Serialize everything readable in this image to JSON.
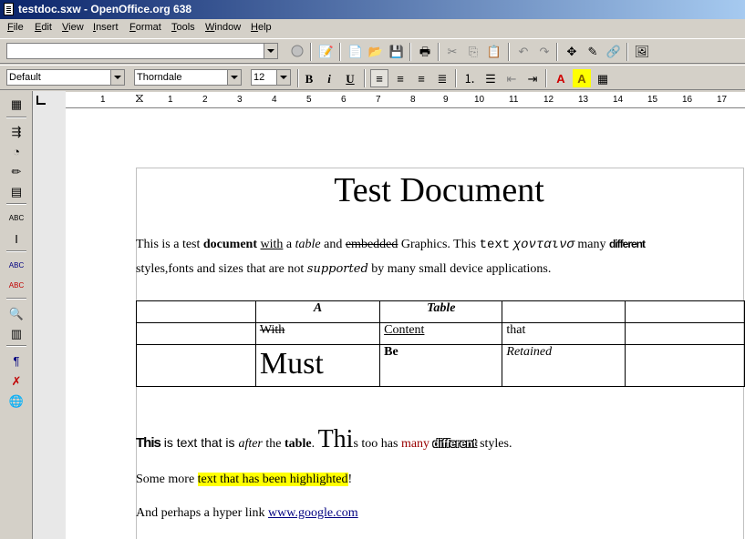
{
  "window": {
    "title": "testdoc.sxw - OpenOffice.org 638"
  },
  "menu": [
    "File",
    "Edit",
    "View",
    "Insert",
    "Format",
    "Tools",
    "Window",
    "Help"
  ],
  "format_bar": {
    "style": "Default",
    "font": "Thorndale",
    "size": "12"
  },
  "ruler": {
    "ticks": [
      "1",
      "1",
      "2",
      "3",
      "4",
      "5",
      "6",
      "7",
      "8",
      "9",
      "10",
      "11",
      "12",
      "13",
      "14",
      "15",
      "16",
      "17"
    ]
  },
  "document": {
    "title": "Test Document",
    "para1": {
      "p1": "This is a test ",
      "bold": "document",
      "sp1": " ",
      "underline": "with",
      "sp2": " a ",
      "italic": "table",
      "sp3": " and ",
      "strike": "embedded",
      "sp4": " Graphics. This ",
      "mono": "text",
      "sp5": " ",
      "greek": "χονταινσ",
      "sp6": " many ",
      "cond": "different",
      "line2a": "styles,fonts and sizes that are not ",
      "hand": "supported",
      "line2b": " by many small device applications."
    },
    "table": {
      "rows": [
        [
          "",
          "A",
          "Table",
          "",
          ""
        ],
        [
          "",
          "With",
          "Content",
          "that",
          ""
        ],
        [
          "",
          "Must",
          "Be",
          "Retained",
          ""
        ]
      ]
    },
    "para2": {
      "bold_this": "This",
      "t1": " is text that is ",
      "italic": "after",
      "t2": " the ",
      "bold_table": "table",
      "t3": ". ",
      "big": "Thi",
      "t4": "s too has ",
      "red": "many",
      "t5": " ",
      "outline": "different",
      "t6": " styles."
    },
    "para3": {
      "t1": "Some more ",
      "highlight": "text that has been highlighted",
      "t2": "!"
    },
    "para4": {
      "t1": "And perhaps a hyper link ",
      "link": "www.google.com"
    }
  }
}
